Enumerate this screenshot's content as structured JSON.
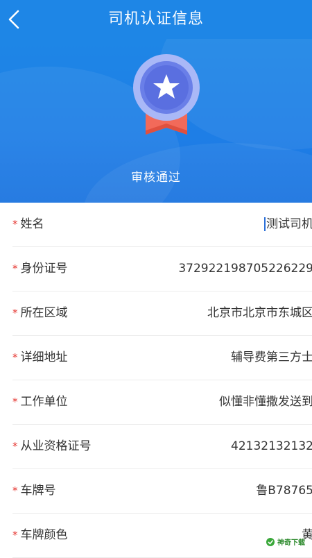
{
  "header": {
    "title": "司机认证信息"
  },
  "status": {
    "text": "审核通过"
  },
  "fields": [
    {
      "label": "姓名",
      "value": "测试司机",
      "required": "*"
    },
    {
      "label": "身份证号",
      "value": "372922198705226229",
      "required": "*"
    },
    {
      "label": "所在区域",
      "value": "北京市北京市东城区",
      "required": "*"
    },
    {
      "label": "详细地址",
      "value": "辅导费第三方士",
      "required": "*"
    },
    {
      "label": "工作单位",
      "value": "似懂非懂撒发送到",
      "required": "*"
    },
    {
      "label": "从业资格证号",
      "value": "42132132132",
      "required": "*"
    },
    {
      "label": "车牌号",
      "value": "鲁B78765",
      "required": "*"
    },
    {
      "label": "车牌颜色",
      "value": "黄",
      "required": "*"
    }
  ],
  "watermark": {
    "text": "神奇下载"
  },
  "icons": [
    "back-icon",
    "award-badge-icon"
  ],
  "colors": {
    "primary": "#1E86E6",
    "required_star": "#E5322D",
    "ribbon": "#F26A5A"
  }
}
